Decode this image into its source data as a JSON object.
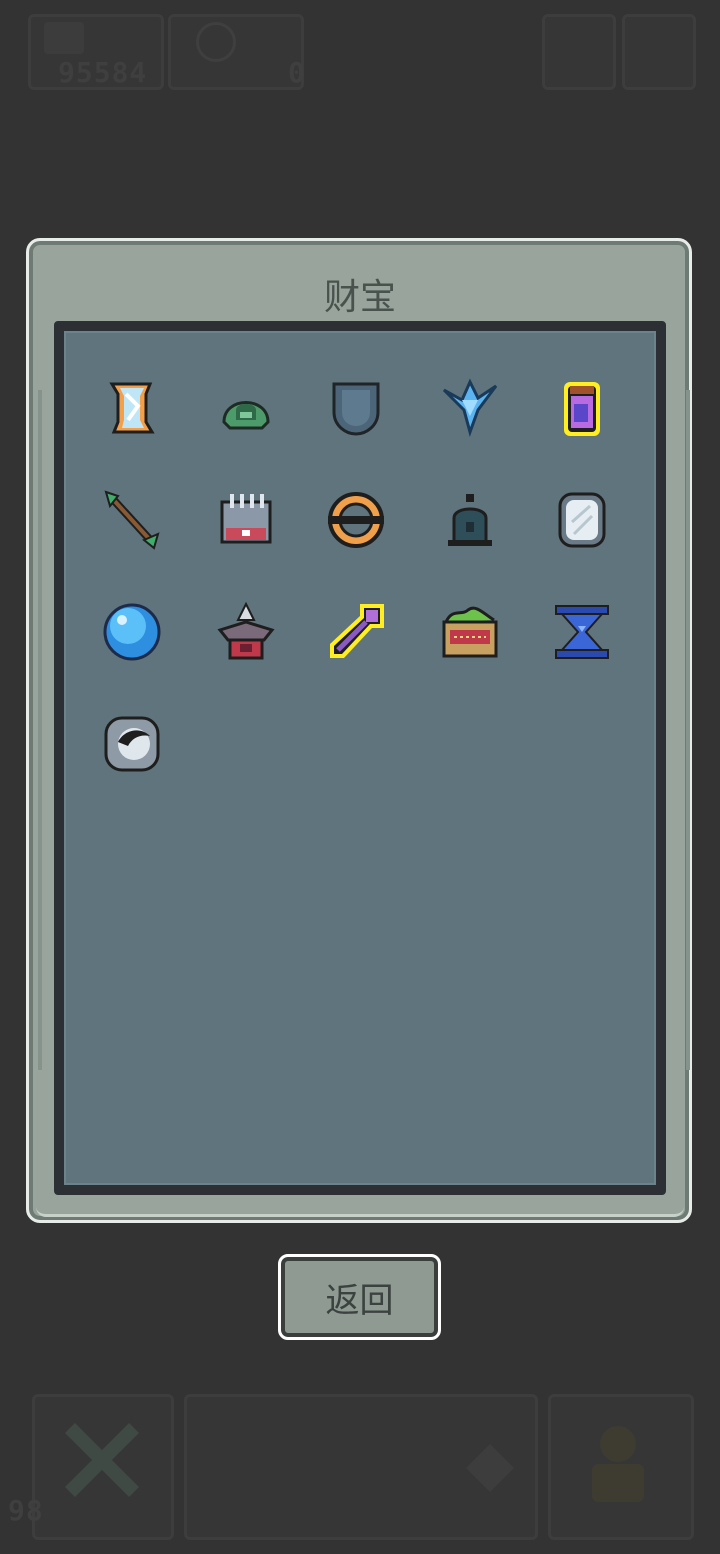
{
  "hud": {
    "gold_amount": "95584",
    "gem_amount": "0",
    "level_indicator": "98"
  },
  "treasure": {
    "title": "财宝",
    "items": [
      {
        "icon": "ice-scroll-icon"
      },
      {
        "icon": "green-helmet-icon"
      },
      {
        "icon": "steel-shield-icon"
      },
      {
        "icon": "ice-crystal-icon"
      },
      {
        "icon": "potion-jar-icon",
        "highlighted": true
      },
      {
        "icon": "green-arrow-icon"
      },
      {
        "icon": "spiked-gauntlet-icon"
      },
      {
        "icon": "orange-ring-icon"
      },
      {
        "icon": "dark-bell-icon"
      },
      {
        "icon": "silver-mirror-icon"
      },
      {
        "icon": "blue-orb-icon"
      },
      {
        "icon": "crossbow-turret-icon"
      },
      {
        "icon": "magic-key-icon",
        "highlighted": true
      },
      {
        "icon": "herb-chest-icon"
      },
      {
        "icon": "hourglass-icon"
      },
      {
        "icon": "eye-stone-icon"
      }
    ]
  },
  "buttons": {
    "back_label": "返回"
  },
  "colors": {
    "background": "#333333",
    "panel": "#98a49c",
    "inner_panel": "#5f747c",
    "highlight": "#ffee22"
  }
}
